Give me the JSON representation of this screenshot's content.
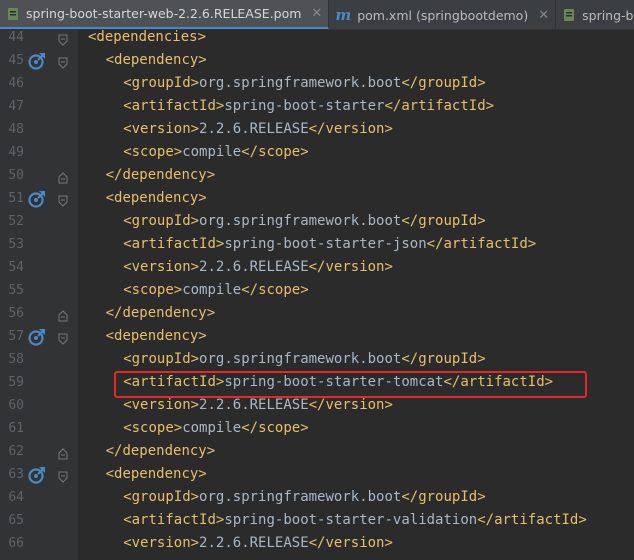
{
  "tabs": [
    {
      "label": "spring-boot-starter-web-2.2.6.RELEASE.pom",
      "icon": "pom-file-icon",
      "active": true
    },
    {
      "label": "pom.xml (springbootdemo)",
      "icon": "maven-m-icon",
      "active": false
    },
    {
      "label": "spring-boot-sta",
      "icon": "pom-file-icon",
      "active": false
    }
  ],
  "lines": [
    {
      "num": "44",
      "indent": 1,
      "open": "dependencies",
      "text": "",
      "close": ""
    },
    {
      "num": "45",
      "indent": 2,
      "open": "dependency",
      "text": "",
      "close": "",
      "marker": true
    },
    {
      "num": "46",
      "indent": 3,
      "open": "groupId",
      "text": "org.springframework.boot",
      "close": "groupId"
    },
    {
      "num": "47",
      "indent": 3,
      "open": "artifactId",
      "text": "spring-boot-starter",
      "close": "artifactId"
    },
    {
      "num": "48",
      "indent": 3,
      "open": "version",
      "text": "2.2.6.RELEASE",
      "close": "version"
    },
    {
      "num": "49",
      "indent": 3,
      "open": "scope",
      "text": "compile",
      "close": "scope"
    },
    {
      "num": "50",
      "indent": 2,
      "open": "",
      "text": "",
      "close": "dependency"
    },
    {
      "num": "51",
      "indent": 2,
      "open": "dependency",
      "text": "",
      "close": "",
      "marker": true
    },
    {
      "num": "52",
      "indent": 3,
      "open": "groupId",
      "text": "org.springframework.boot",
      "close": "groupId"
    },
    {
      "num": "53",
      "indent": 3,
      "open": "artifactId",
      "text": "spring-boot-starter-json",
      "close": "artifactId"
    },
    {
      "num": "54",
      "indent": 3,
      "open": "version",
      "text": "2.2.6.RELEASE",
      "close": "version"
    },
    {
      "num": "55",
      "indent": 3,
      "open": "scope",
      "text": "compile",
      "close": "scope"
    },
    {
      "num": "56",
      "indent": 2,
      "open": "",
      "text": "",
      "close": "dependency"
    },
    {
      "num": "57",
      "indent": 2,
      "open": "dependency",
      "text": "",
      "close": "",
      "marker": true
    },
    {
      "num": "58",
      "indent": 3,
      "open": "groupId",
      "text": "org.springframework.boot",
      "close": "groupId"
    },
    {
      "num": "59",
      "indent": 3,
      "open": "artifactId",
      "text": "spring-boot-starter-tomcat",
      "close": "artifactId",
      "highlighted": true
    },
    {
      "num": "60",
      "indent": 3,
      "open": "version",
      "text": "2.2.6.RELEASE",
      "close": "version"
    },
    {
      "num": "61",
      "indent": 3,
      "open": "scope",
      "text": "compile",
      "close": "scope"
    },
    {
      "num": "62",
      "indent": 2,
      "open": "",
      "text": "",
      "close": "dependency"
    },
    {
      "num": "63",
      "indent": 2,
      "open": "dependency",
      "text": "",
      "close": "",
      "marker": true
    },
    {
      "num": "64",
      "indent": 3,
      "open": "groupId",
      "text": "org.springframework.boot",
      "close": "groupId"
    },
    {
      "num": "65",
      "indent": 3,
      "open": "artifactId",
      "text": "spring-boot-starter-validation",
      "close": "artifactId"
    },
    {
      "num": "66",
      "indent": 3,
      "open": "version",
      "text": "2.2.6.RELEASE",
      "close": "version"
    }
  ],
  "colors": {
    "tag": "#e8bf6a",
    "text": "#a9b7c6",
    "line_number": "#606366",
    "highlight_border": "#e5262a",
    "marker": "#4a88c7"
  }
}
